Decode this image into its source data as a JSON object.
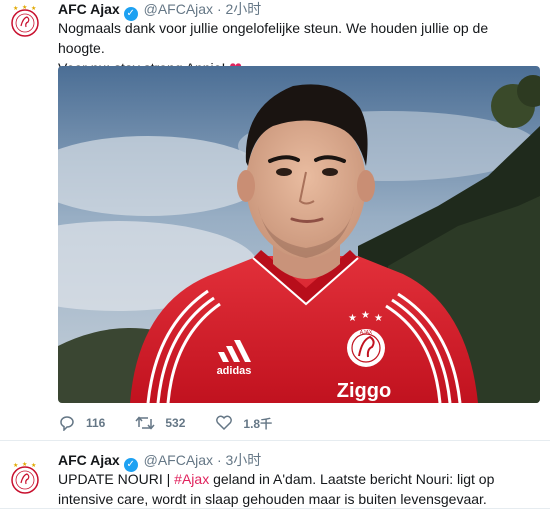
{
  "tweets": [
    {
      "name": "AFC Ajax",
      "handle": "@AFCAjax",
      "separator": "·",
      "time": "2小时",
      "text_line1": "Nogmaals dank voor jullie ongelofelijke steun. We houden jullie op de hoogte.",
      "text_line2": "Voor nu: stay strong Appie!",
      "emoji": "heart",
      "stats": {
        "replies": "116",
        "retweets": "532",
        "likes": "1.8千"
      }
    },
    {
      "name": "AFC Ajax",
      "handle": "@AFCAjax",
      "separator": "·",
      "time": "3小时",
      "text_prefix": "UPDATE NOURI | ",
      "hashtag": "#Ajax",
      "text_rest": " geland in A'dam. Laatste bericht Nouri: ligt op intensive care, wordt in slaap gehouden maar is buiten levensgevaar."
    }
  ],
  "photo": {
    "shirt_sponsor": "Ziggo",
    "kit_brand": "adidas",
    "badge": "AJAX"
  },
  "colors": {
    "verified": "#1da1f2",
    "hashtag": "#e0245e",
    "secondary_text": "#657786",
    "shirt_red": "#d6202e"
  },
  "icons": [
    "reply-icon",
    "retweet-icon",
    "like-icon",
    "verified-icon"
  ]
}
